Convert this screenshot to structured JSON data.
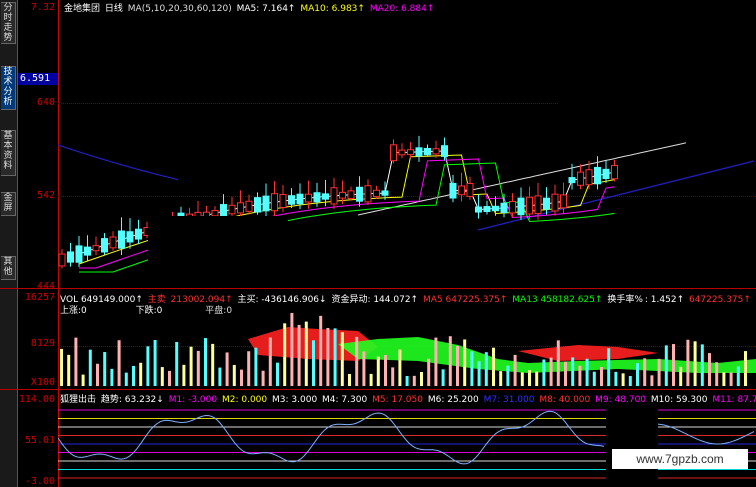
{
  "tabs": [
    {
      "label": "分时走势",
      "active": false
    },
    {
      "label": "技术分析",
      "active": true
    },
    {
      "label": "基本资料",
      "active": false
    },
    {
      "label": "金屏",
      "active": false
    },
    {
      "label": "其他",
      "active": false
    }
  ],
  "price_axis": {
    "top": "7.32",
    "current": "6.591",
    "l640": "640",
    "l542": "542",
    "l444": "444"
  },
  "price_legend": {
    "stock": "金地集团",
    "period": "日线",
    "ma_params": "MA(5,10,20,30,60,120)",
    "ma5": "MA5: 7.164↑",
    "ma10": "MA10: 6.983↑",
    "ma20": "MA20: 6.884↑"
  },
  "vol_axis": {
    "top": "16257",
    "mid": "8129",
    "unit": "X100"
  },
  "vol_legend": {
    "vol": "VOL 649149.000↑",
    "main_sell_label": "主卖",
    "main_sell": "213002.094↑",
    "main_buy": "主买: -436146.906↓",
    "capital": "资金异动: 144.072↑",
    "ma5": "MA5 647225.375↑",
    "ma13": "MA13 458182.625↑",
    "turnover_label": "换手率%",
    "turnover": ": 1.452↑",
    "extra1": "647225.375↑",
    "extra2": "6472"
  },
  "vol_sub_legend": {
    "up": "上涨:0",
    "down": "下跌:0",
    "flat": "平盘:0"
  },
  "ind_axis": {
    "top": "114.00",
    "mid": "55.01",
    "bottom": "-3.00"
  },
  "ind_legend": {
    "name": "狐狸出击",
    "trend": "趋势: 63.232↓",
    "m1": "M1: -3.000",
    "m2": "M2: 0.000",
    "m3": "M3: 3.000",
    "m4": "M4: 7.300",
    "m5": "M5: 17.050",
    "m6": "M6: 25.200",
    "m7": "M7: 31.000",
    "m8": "M8: 40.000",
    "m9": "M9: 48.700",
    "m10": "M10: 59.300",
    "m11": "M11: 87.70"
  },
  "watermark": "www.7gpzb.com",
  "colors": {
    "up": "#ff3030",
    "down": "#54ffff",
    "ma5": "#ffffff",
    "ma10": "#ffff00",
    "ma20": "#ff00ff",
    "ma30": "#00ff00",
    "ma60": "#dddddd",
    "ma120": "#2020c0",
    "axis": "#cc0000"
  }
}
